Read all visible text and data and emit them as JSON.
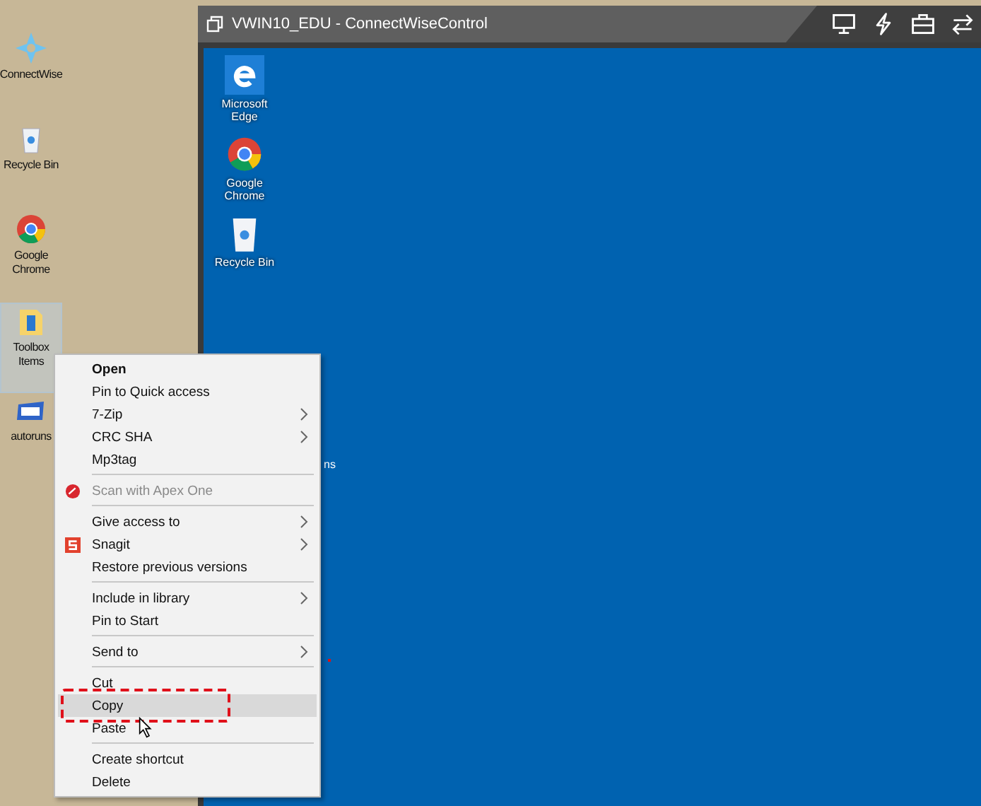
{
  "local_desktop": {
    "icons": [
      {
        "label": "ConnectWise",
        "kind": "compass",
        "selected": false
      },
      {
        "label": "Recycle Bin",
        "kind": "bin",
        "selected": false
      },
      {
        "label": "Google Chrome",
        "kind": "chrome",
        "selected": false
      },
      {
        "label": "Toolbox Items",
        "kind": "folder",
        "selected": true
      },
      {
        "label": "autoruns",
        "kind": "window",
        "selected": false
      }
    ]
  },
  "remote_window": {
    "title": "VWIN10_EDU - ConnectWiseControl",
    "desktop_icons": [
      {
        "label": "Microsoft Edge",
        "kind": "edge"
      },
      {
        "label": "Google Chrome",
        "kind": "chrome"
      },
      {
        "label": "Recycle Bin",
        "kind": "bin"
      }
    ],
    "hidden_icon_label": "ns"
  },
  "context_menu": {
    "items": [
      {
        "kind": "item",
        "label": "Open",
        "bold": true,
        "submenu": false,
        "disabled": false,
        "selected": false,
        "marked": false
      },
      {
        "kind": "item",
        "label": "Pin to Quick access",
        "bold": false,
        "submenu": false,
        "disabled": false,
        "selected": false,
        "marked": false
      },
      {
        "kind": "item",
        "label": "7-Zip",
        "bold": false,
        "submenu": true,
        "disabled": false,
        "selected": false,
        "marked": false
      },
      {
        "kind": "item",
        "label": "CRC SHA",
        "bold": false,
        "submenu": true,
        "disabled": false,
        "selected": false,
        "marked": false
      },
      {
        "kind": "item",
        "label": "Mp3tag",
        "bold": false,
        "submenu": false,
        "disabled": false,
        "selected": false,
        "marked": false
      },
      {
        "kind": "separator"
      },
      {
        "kind": "scanner",
        "label": "Scan with Apex One",
        "bold": false,
        "submenu": false,
        "disabled": true,
        "selected": false,
        "marked": false
      },
      {
        "kind": "separator"
      },
      {
        "kind": "item",
        "label": "Give access to",
        "bold": false,
        "submenu": true,
        "disabled": false,
        "selected": false,
        "marked": false
      },
      {
        "kind": "capture",
        "label": "Snagit",
        "bold": false,
        "submenu": true,
        "disabled": false,
        "selected": false,
        "marked": false
      },
      {
        "kind": "item",
        "label": "Restore previous versions",
        "bold": false,
        "submenu": false,
        "disabled": false,
        "selected": false,
        "marked": false
      },
      {
        "kind": "separator"
      },
      {
        "kind": "item",
        "label": "Include in library",
        "bold": false,
        "submenu": true,
        "disabled": false,
        "selected": false,
        "marked": false
      },
      {
        "kind": "item",
        "label": "Pin to Start",
        "bold": false,
        "submenu": false,
        "disabled": false,
        "selected": false,
        "marked": false
      },
      {
        "kind": "separator"
      },
      {
        "kind": "item",
        "label": "Send to",
        "bold": false,
        "submenu": true,
        "disabled": false,
        "selected": false,
        "marked": false
      },
      {
        "kind": "separator"
      },
      {
        "kind": "item",
        "label": "Cut",
        "bold": false,
        "submenu": false,
        "disabled": false,
        "selected": false,
        "marked": false
      },
      {
        "kind": "item",
        "label": "Copy",
        "bold": false,
        "submenu": false,
        "disabled": false,
        "selected": true,
        "marked": true
      },
      {
        "kind": "item",
        "label": "Paste",
        "bold": false,
        "submenu": false,
        "disabled": false,
        "selected": false,
        "marked": false
      },
      {
        "kind": "separator"
      },
      {
        "kind": "item",
        "label": "Create shortcut",
        "bold": false,
        "submenu": false,
        "disabled": false,
        "selected": false,
        "marked": false
      },
      {
        "kind": "item",
        "label": "Delete",
        "bold": false,
        "submenu": false,
        "disabled": false,
        "selected": false,
        "marked": false
      }
    ]
  }
}
